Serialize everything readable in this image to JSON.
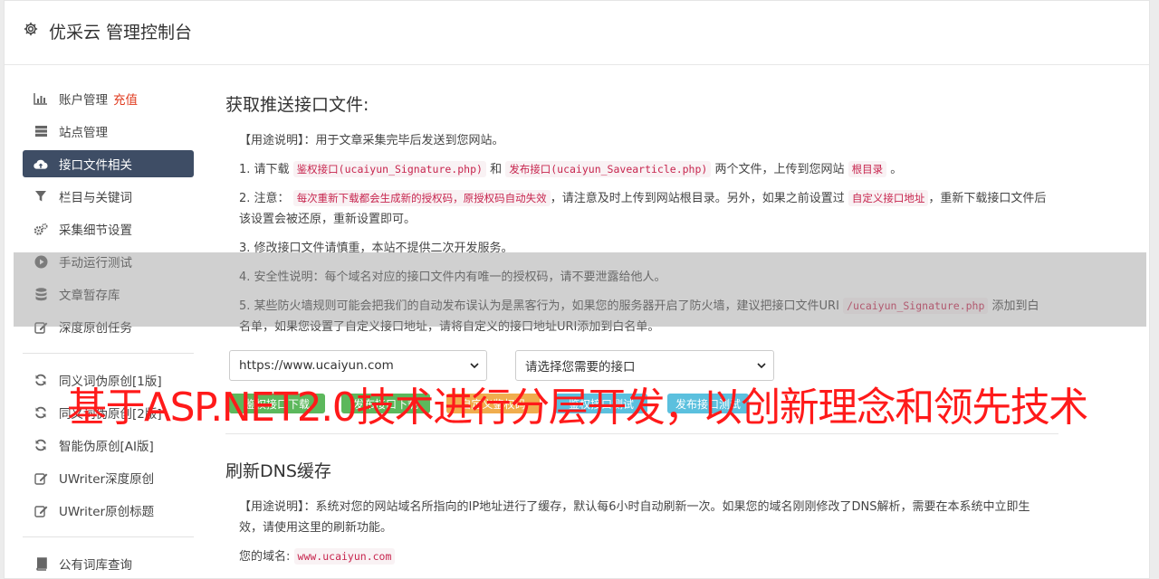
{
  "app": {
    "title": "优采云 管理控制台"
  },
  "sidebar": {
    "groups": [
      [
        {
          "label": "账户管理",
          "badge": "充值",
          "icon": "bar-chart-icon"
        },
        {
          "label": "站点管理",
          "icon": "server-icon"
        },
        {
          "label": "接口文件相关",
          "icon": "cloud-upload-icon",
          "active": true
        },
        {
          "label": "栏目与关键词",
          "icon": "filter-icon"
        },
        {
          "label": "采集细节设置",
          "icon": "gears-icon"
        },
        {
          "label": "手动运行测试",
          "icon": "play-circle-icon"
        },
        {
          "label": "文章暂存库",
          "icon": "database-icon"
        },
        {
          "label": "深度原创任务",
          "icon": "edit-icon"
        }
      ],
      [
        {
          "label": "同义词伪原创[1版]",
          "icon": "refresh-icon"
        },
        {
          "label": "同义词伪原创[2版]",
          "icon": "refresh-icon"
        },
        {
          "label": "智能伪原创[AI版]",
          "icon": "refresh-icon"
        },
        {
          "label": "UWriter深度原创",
          "icon": "edit-icon"
        },
        {
          "label": "UWriter原创标题",
          "icon": "edit-icon"
        }
      ],
      [
        {
          "label": "公有词库查询",
          "icon": "book-icon"
        }
      ]
    ]
  },
  "section1": {
    "title": "获取推送接口文件:",
    "usage": {
      "tag": "【用途说明】",
      "text": "：用于文章采集完毕后发送到您网站。"
    },
    "p1": {
      "a": "1. 请下载",
      "code1": "鉴权接口(ucaiyun_Signature.php)",
      "b": "和",
      "code2": "发布接口(ucaiyun_Savearticle.php)",
      "c": "两个文件，上传到您网站",
      "code3": "根目录",
      "d": "。"
    },
    "p2": {
      "a": "2. 注意：",
      "code1": "每次重新下载都会生成新的授权码，原授权码自动失效",
      "b": "，请注意及时上传到网站根目录。另外，如果之前设置过",
      "code2": "自定义接口地址",
      "c": "，重新下载接口文件后该设置会被还原，重新设置即可。"
    },
    "p3": "3. 修改接口文件请慎重，本站不提供二次开发服务。",
    "p4": "4. 安全性说明：每个域名对应的接口文件内有唯一的授权码，请不要泄露给他人。",
    "p5": {
      "a": "5. 某些防火墙规则可能会把我们的自动发布误认为是黑客行为，如果您的服务器开启了防火墙，建议把接口文件URI",
      "code1": "/ucaiyun_Signature.php",
      "b": "添加到白名单，如果您设置了自定义接口地址，请将自定义的接口地址URI添加到白名单。"
    },
    "site_select": "https://www.ucaiyun.com",
    "api_select": "请选择您需要的接口",
    "buttons": [
      {
        "label": "鉴权接口下载",
        "color": "#5cb85c"
      },
      {
        "label": "发布接口下载",
        "color": "#5cb85c"
      },
      {
        "label": "自定义鉴权码",
        "color": "#f0ad4e"
      },
      {
        "label": "鉴权接口测试",
        "color": "#5bc0de"
      },
      {
        "label": "发布接口测试",
        "color": "#5bc0de"
      }
    ]
  },
  "section2": {
    "title": "刷新DNS缓存",
    "usage": {
      "tag": "【用途说明】",
      "text": "：系统对您的网站域名所指向的IP地址进行了缓存，默认每6小时自动刷新一次。如果您的域名刚刚修改了DNS解析，需要在本系统中立即生效，请使用这里的刷新功能。"
    },
    "domain_label": "您的域名:",
    "domain_value": "www.ucaiyun.com"
  },
  "overlay_text": "基于ASP.NET2.0技术进行分层开发，以创新理念和领先技术"
}
